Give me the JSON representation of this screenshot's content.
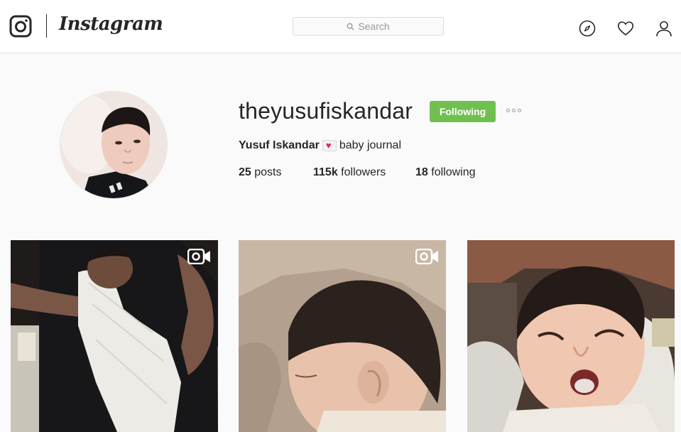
{
  "header": {
    "brand": "Instagram",
    "search_placeholder": "Search",
    "icons": [
      "instagram-glyph-icon",
      "search-icon",
      "compass-icon",
      "heart-icon",
      "user-icon"
    ]
  },
  "profile": {
    "username": "theyusufiskandar",
    "follow_button": "Following",
    "full_name": "Yusuf Iskandar",
    "bio": "baby journal",
    "stats": {
      "posts_count": "25",
      "posts_label": "posts",
      "followers_count": "115k",
      "followers_label": "followers",
      "following_count": "18",
      "following_label": "following"
    }
  },
  "posts": [
    {
      "type": "video",
      "subject": "baby held by adult"
    },
    {
      "type": "video",
      "subject": "sleeping baby close-up"
    },
    {
      "type": "photo",
      "subject": "yawning baby"
    }
  ],
  "colors": {
    "follow_button_bg": "#70c050",
    "background": "#fafafa",
    "text": "#262626",
    "border": "#dbdbdb"
  }
}
